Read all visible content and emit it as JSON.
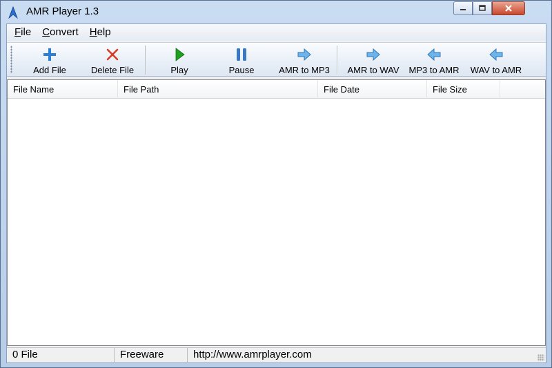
{
  "window": {
    "title": "AMR Player 1.3",
    "icon": "amr-app-icon"
  },
  "menu": [
    {
      "label": "File",
      "mnemonic": "F",
      "rest": "ile"
    },
    {
      "label": "Convert",
      "mnemonic": "C",
      "rest": "onvert"
    },
    {
      "label": "Help",
      "mnemonic": "H",
      "rest": "elp"
    }
  ],
  "toolbar": {
    "add_file": "Add File",
    "delete_file": "Delete File",
    "play": "Play",
    "pause": "Pause",
    "amr_to_mp3": "AMR to MP3",
    "amr_to_wav": "AMR to WAV",
    "mp3_to_amr": "MP3 to AMR",
    "wav_to_amr": "WAV to AMR"
  },
  "colors": {
    "add": "#2b7fd6",
    "delete": "#d83a22",
    "play": "#1fa01f",
    "pause": "#3b78c4",
    "arrow": "#6db4ea"
  },
  "list": {
    "columns": [
      "File Name",
      "File Path",
      "File Date",
      "File Size"
    ],
    "rows": []
  },
  "status": {
    "count": "0 File",
    "license": "Freeware",
    "url": "http://www.amrplayer.com"
  }
}
